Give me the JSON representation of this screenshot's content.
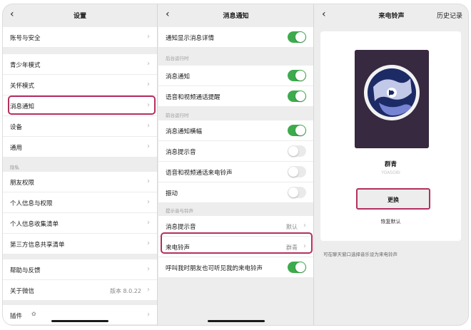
{
  "panel1": {
    "title": "设置",
    "back_icon": "‹",
    "items": [
      {
        "label": "账号与安全"
      },
      {
        "label": "青少年模式"
      },
      {
        "label": "关怀模式"
      },
      {
        "label": "消息通知"
      },
      {
        "label": "设备"
      },
      {
        "label": "通用"
      },
      {
        "label": "朋友权限"
      },
      {
        "label": "个人信息与权限"
      },
      {
        "label": "个人信息收集清单"
      },
      {
        "label": "第三方信息共享清单"
      },
      {
        "label": "帮助与反馈"
      },
      {
        "label": "关于微信",
        "value": "版本 8.0.22"
      },
      {
        "label": "插件"
      }
    ],
    "section_privacy": "隐私"
  },
  "panel2": {
    "title": "消息通知",
    "back_icon": "‹",
    "top_item": {
      "label": "通知显示消息详情",
      "on": true
    },
    "section1": "后台运行时",
    "item_notify": {
      "label": "消息通知",
      "on": true
    },
    "item_call": {
      "label": "语音和视频通话提醒",
      "on": true
    },
    "section2": "前台运行时",
    "item_banner": {
      "label": "消息通知横幅",
      "on": true
    },
    "item_sound": {
      "label": "消息提示音",
      "on": false
    },
    "item_ringtone_fg": {
      "label": "语音和视频通话来电铃声",
      "on": false
    },
    "item_vibrate": {
      "label": "振动",
      "on": false
    },
    "section3": "提示音与铃声",
    "item_msg_tone": {
      "label": "消息提示音",
      "value": "默认"
    },
    "item_ringtone": {
      "label": "来电铃声",
      "value": "群青"
    },
    "item_friend": {
      "label": "呼叫我时朋友也可听见我的来电铃声",
      "on": true
    }
  },
  "panel3": {
    "title": "来电铃声",
    "back_icon": "‹",
    "history": "历史记录",
    "ringtone_name": "群青",
    "ringtone_sub": "YOASOBI",
    "change_button": "更换",
    "restore_label": "恢复默认",
    "hint": "可在聊天窗口选择音乐设为来电铃声"
  },
  "colors": {
    "toggle_on": "#3dab4d",
    "highlight": "#b3305f",
    "background": "#ededed"
  }
}
